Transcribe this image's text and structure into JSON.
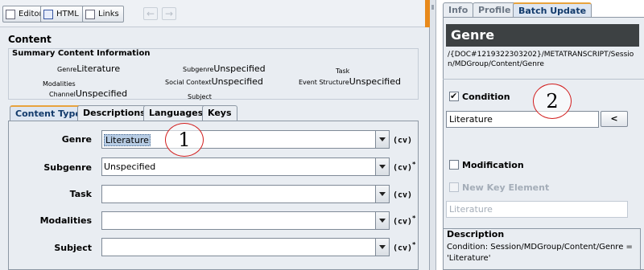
{
  "toolbar": {
    "editor_label": "Editor",
    "html_label": "HTML",
    "links_label": "Links",
    "back_glyph": "←",
    "forward_glyph": "→"
  },
  "content": {
    "title": "Content",
    "summary_title": "Summary Content Information",
    "summary": [
      {
        "label": "Genre",
        "value": "Literature"
      },
      {
        "label": "Subgenre",
        "value": "Unspecified"
      },
      {
        "label": "Task",
        "value": ""
      },
      {
        "label": "Modalities",
        "value": ""
      },
      {
        "label": "Social Context",
        "value": "Unspecified"
      },
      {
        "label": "Event Structure",
        "value": "Unspecified"
      },
      {
        "label": "Channel",
        "value": "Unspecified"
      },
      {
        "label": "Subject",
        "value": ""
      }
    ],
    "tabs": [
      "Content Type",
      "Descriptions",
      "Languages",
      "Keys"
    ],
    "active_tab": "Content Type",
    "fields": [
      {
        "label": "Genre",
        "value": "Literature",
        "cv": "(cv)",
        "star": ""
      },
      {
        "label": "Subgenre",
        "value": "Unspecified",
        "cv": "(cv)",
        "star": "*"
      },
      {
        "label": "Task",
        "value": "",
        "cv": "(cv)",
        "star": ""
      },
      {
        "label": "Modalities",
        "value": "",
        "cv": "(cv)",
        "star": "*"
      },
      {
        "label": "Subject",
        "value": "",
        "cv": "(cv)",
        "star": "*"
      }
    ]
  },
  "annotations": {
    "circle1": "1",
    "circle2": "2"
  },
  "right": {
    "tabs": [
      "Info",
      "Profile",
      "Batch Update"
    ],
    "active_tab": "Batch Update",
    "header": "Genre",
    "path": "/{DOC#1219322303202}/METATRANSCRIPT/Session/MDGroup/Content/Genre",
    "condition_label": "Condition",
    "condition_checked": true,
    "condition_value": "Literature",
    "lt_button": "<",
    "modification_label": "Modification",
    "modification_checked": false,
    "new_key_label": "New Key Element",
    "new_key_checked": false,
    "modification_value": "Literature",
    "description_title": "Description",
    "description_text": "Condition: Session/MDGroup/Content/Genre = 'Literature'"
  },
  "colors": {
    "accent_tab": "#e8a33d",
    "header_bg": "#3d4143",
    "circle": "#d21d1d"
  }
}
